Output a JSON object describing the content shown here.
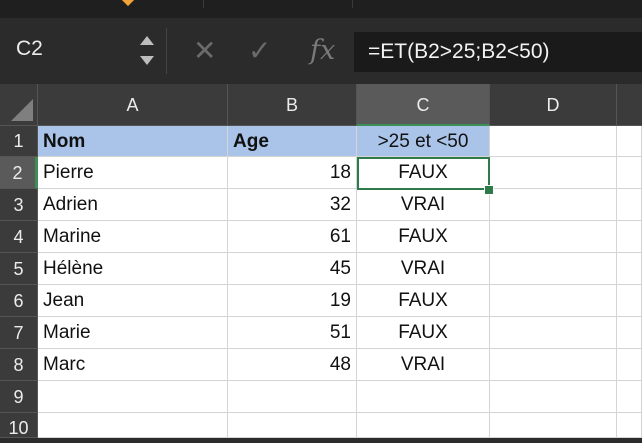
{
  "name_box": {
    "ref": "C2"
  },
  "formula_bar": {
    "formula": "=ET(B2>25;B2<50)",
    "fx_label": "fx"
  },
  "columns": [
    "A",
    "B",
    "C",
    "D"
  ],
  "rows": [
    "1",
    "2",
    "3",
    "4",
    "5",
    "6",
    "7",
    "8",
    "9",
    "10"
  ],
  "header_row": {
    "a": "Nom",
    "b": "Age",
    "c": ">25 et <50"
  },
  "data_rows": [
    {
      "a": "Pierre",
      "b": "18",
      "c": "FAUX"
    },
    {
      "a": "Adrien",
      "b": "32",
      "c": "VRAI"
    },
    {
      "a": "Marine",
      "b": "61",
      "c": "FAUX"
    },
    {
      "a": "Hélène",
      "b": "45",
      "c": "VRAI"
    },
    {
      "a": "Jean",
      "b": "19",
      "c": "FAUX"
    },
    {
      "a": "Marie",
      "b": "51",
      "c": "FAUX"
    },
    {
      "a": "Marc",
      "b": "48",
      "c": "VRAI"
    }
  ],
  "colors": {
    "header_fill": "#a9c4e8",
    "selection": "#2e7a4b"
  }
}
